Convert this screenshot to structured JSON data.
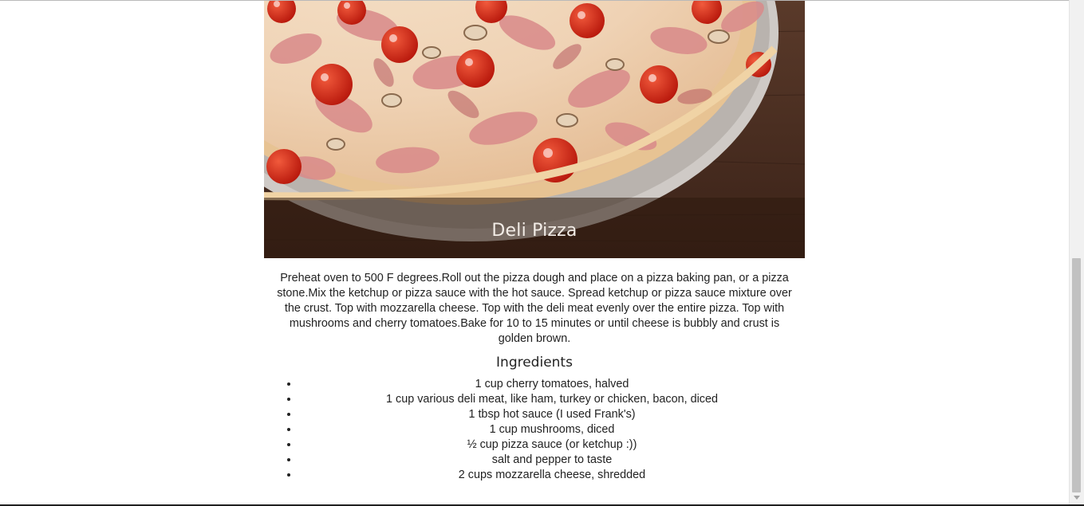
{
  "recipe": {
    "title": "Deli Pizza",
    "description": "Preheat oven to 500 F degrees.Roll out the pizza dough and place on a pizza baking pan, or a pizza stone.Mix the ketchup or pizza sauce with the hot sauce. Spread ketchup or pizza sauce mixture over the crust. Top with mozzarella cheese. Top with the deli meat evenly over the entire pizza. Top with mushrooms and cherry tomatoes.Bake for 10 to 15 minutes or until cheese is bubbly and crust is golden brown.",
    "ingredients_heading": "Ingredients",
    "ingredients": [
      "1 cup cherry tomatoes, halved",
      "1 cup various deli meat, like ham, turkey or chicken, bacon, diced",
      "1 tbsp hot sauce (I used Frank's)",
      "1 cup mushrooms, diced",
      "½ cup pizza sauce (or ketchup :))",
      "salt and pepper to taste",
      "2 cups mozzarella cheese, shredded"
    ]
  },
  "colors": {
    "caption_overlay": "#2d190f",
    "caption_text": "#f2ece6",
    "wood": "#4a2f22",
    "tomato": "#d42a17",
    "cheese": "#f3dcc0",
    "crust": "#e9c99c",
    "pan": "#c9c4c0"
  },
  "hero_image": "deli-pizza-photo"
}
